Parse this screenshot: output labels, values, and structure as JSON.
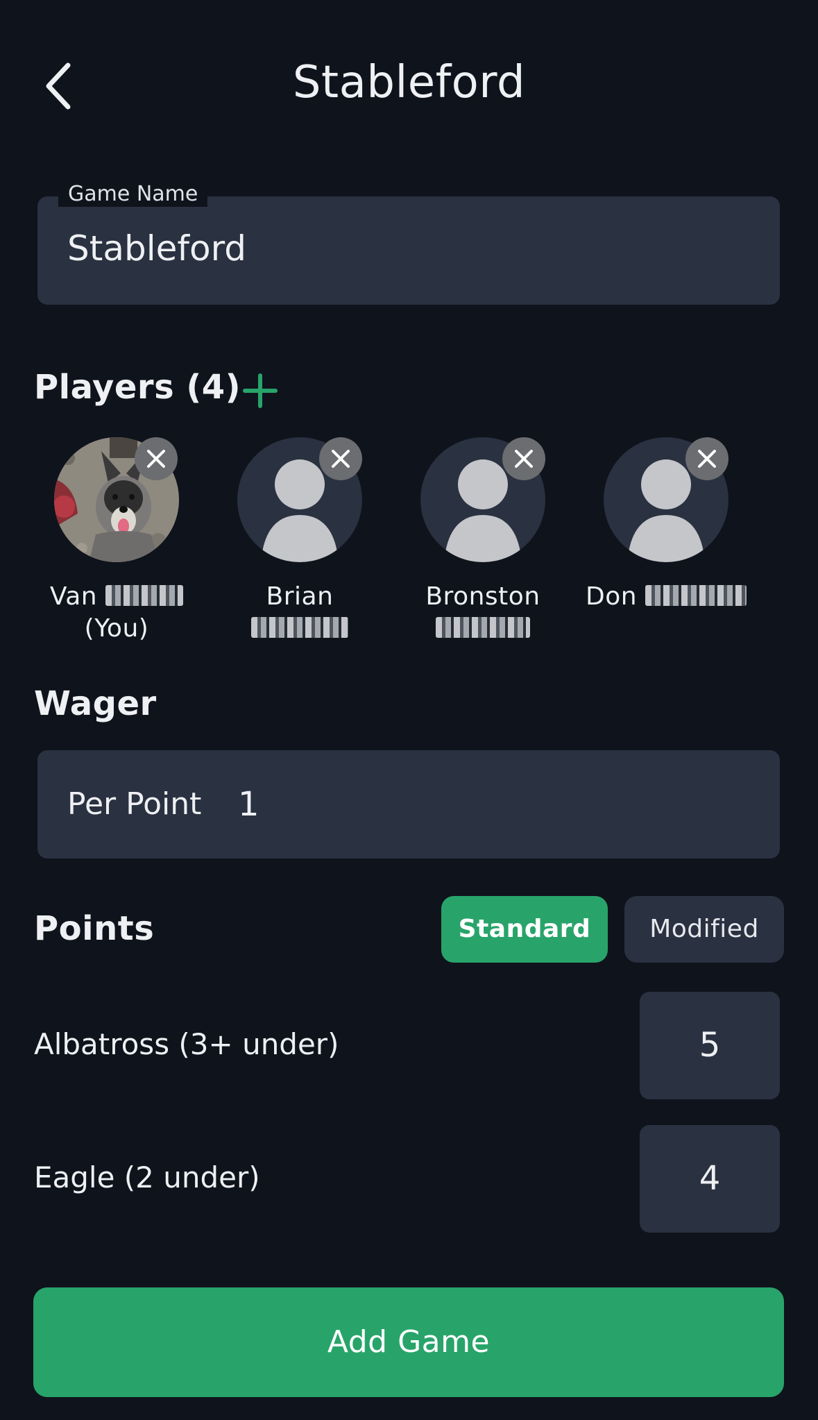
{
  "header": {
    "title": "Stableford",
    "back_icon": "chevron-left-icon"
  },
  "game_name": {
    "label": "Game Name",
    "value": "Stableford"
  },
  "players": {
    "title": "Players (4)",
    "add_icon": "plus-icon",
    "accent_color": "#28a46a",
    "list": [
      {
        "first": "Van",
        "second_line": "(You)",
        "has_photo": true
      },
      {
        "first": "Brian",
        "second_line": "",
        "has_photo": false
      },
      {
        "first": "Bronston",
        "second_line": "",
        "has_photo": false
      },
      {
        "first": "Don",
        "second_line": "",
        "has_photo": false
      }
    ]
  },
  "wager": {
    "title": "Wager",
    "label": "Per Point",
    "value": "1"
  },
  "points": {
    "title": "Points",
    "mode_standard": "Standard",
    "mode_modified": "Modified",
    "selected_mode": "Standard",
    "rows": [
      {
        "label": "Albatross (3+ under)",
        "value": "5"
      },
      {
        "label": "Eagle (2 under)",
        "value": "4"
      }
    ]
  },
  "actions": {
    "add_game": "Add Game"
  },
  "colors": {
    "background": "#0f131c",
    "field": "#2a3140",
    "accent": "#28a46a"
  }
}
